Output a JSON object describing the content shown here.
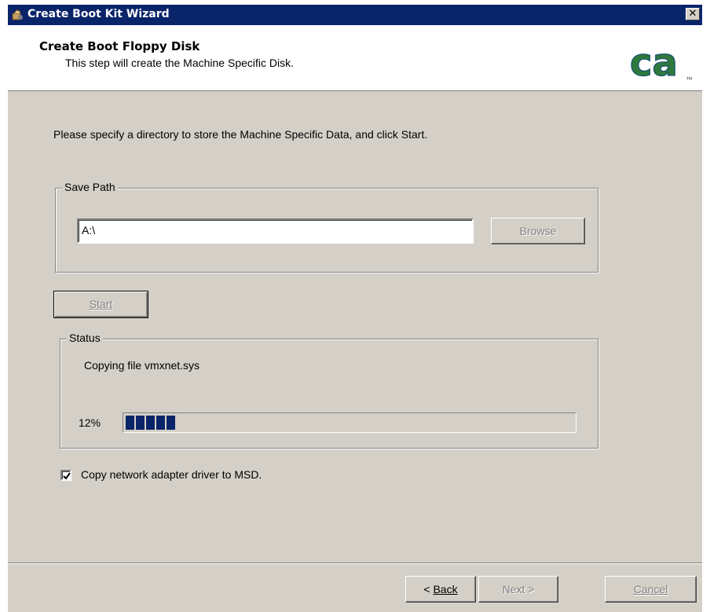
{
  "window": {
    "title": "Create Boot Kit Wizard",
    "close_symbol": "✕"
  },
  "header": {
    "title": "Create Boot Floppy Disk",
    "subtitle": "This step will create the Machine Specific Disk.",
    "logo_text": "ca",
    "logo_tm": "TM"
  },
  "main": {
    "instruction": "Please specify a directory to store the Machine Specific Data, and click Start.",
    "save_path": {
      "group_label": "Save Path",
      "value": "A:\\",
      "browse_label": "Browse"
    },
    "start_label": "Start",
    "status": {
      "group_label": "Status",
      "message": "Copying file vmxnet.sys",
      "percent_label": "12%",
      "progress_percent": 12
    },
    "copy_driver": {
      "label": "Copy network adapter driver to MSD.",
      "checked": true
    }
  },
  "footer": {
    "back_label": "Back",
    "back_prefix": "< ",
    "next_label": "Next >",
    "cancel_label": "Cancel"
  },
  "colors": {
    "titlebar": "#0a246a",
    "dialog_face": "#d4d0c8",
    "progress_fill": "#0a246a",
    "logo_green": "#2f7a3a",
    "logo_teal": "#2e6f8e"
  },
  "icons": {
    "title": "app-icon",
    "close": "close-icon",
    "checkbox": "checkmark-icon"
  }
}
